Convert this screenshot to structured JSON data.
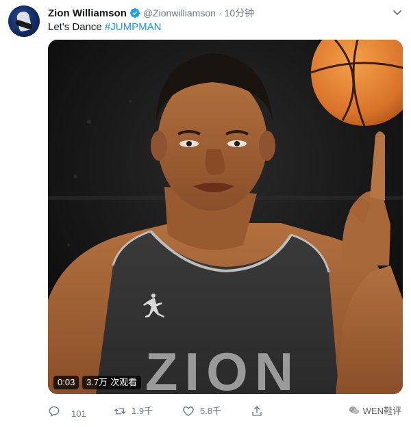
{
  "tweet": {
    "author_name": "Zion Williamson",
    "handle": "@Zionwilliamson",
    "separator": "·",
    "time": "10分钟",
    "text_prefix": "Let's Dance ",
    "hashtag": "#JUMPMAN",
    "verified": true
  },
  "video": {
    "duration": "0:03",
    "views_count": "3.7万",
    "views_label": "次观看",
    "jersey_text": "ZION"
  },
  "actions": {
    "reply_count": "101",
    "retweet_count": "1.9千",
    "like_count": "5.8千"
  },
  "watermark": {
    "text": "WEN鞋评"
  },
  "icons": {
    "verified": "verified-badge-icon",
    "more": "chevron-down-icon",
    "reply": "reply-icon",
    "retweet": "retweet-icon",
    "like": "heart-icon",
    "share": "share-icon",
    "watermark": "wechat-icon"
  },
  "colors": {
    "link": "#1b95e0",
    "secondary_text": "#657786",
    "verified": "#1da1f2"
  }
}
